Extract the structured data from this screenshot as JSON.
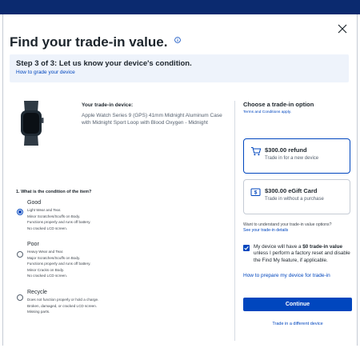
{
  "modal": {
    "title": "Find your trade-in value.",
    "step_title": "Step 3 of 3: Let us know your device's condition.",
    "step_link": "How to grade your device"
  },
  "device": {
    "label": "Your trade-in device:",
    "name": "Apple Watch Series 9 (GPS) 41mm Midnight Aluminum Case with Midnight Sport Loop with Blood Oxygen - Midnight"
  },
  "condition": {
    "question": "1. What is the condition of the item?",
    "options": [
      {
        "name": "Good",
        "selected": true,
        "lines": [
          "Light Wear and Tear.",
          "Minor Scratches/Scuffs on Body.",
          "Functions properly and runs off battery.",
          "No cracked LCD screen."
        ]
      },
      {
        "name": "Poor",
        "selected": false,
        "lines": [
          "Heavy Wear and Tear.",
          "Major Scratches/Scuffs on Body.",
          "Functions properly and runs off battery.",
          "Minor Cracks on Body.",
          "No cracked LCD screen."
        ]
      },
      {
        "name": "Recycle",
        "selected": false,
        "lines": [
          "Does not function properly or hold a charge.",
          "Broken, damaged, or cracked LCD screen.",
          "Missing parts."
        ]
      }
    ]
  },
  "trade_option": {
    "heading": "Choose a trade-in option",
    "terms": "Terms and Conditions apply.",
    "options": [
      {
        "title": "$300.00 refund",
        "subtitle": "Trade in for a new device",
        "icon": "cart-icon",
        "selected": true
      },
      {
        "title": "$300.00 eGift Card",
        "subtitle": "Trade in without a purchase",
        "icon": "dollar-card-icon",
        "selected": false
      }
    ],
    "understand_text": "Want to understand your trade-in value options?",
    "understand_link": "See your trade-in details",
    "check_pre": "My device will have a ",
    "check_bold": "$0 trade-in value",
    "check_post": " unless I perform a factory reset and disable the Find My feature, if applicable.",
    "checked": true,
    "prepare_link": "How to prepare my device for trade-in",
    "continue_label": "Continue",
    "different_link": "Trade in a different device"
  },
  "colors": {
    "accent": "#0046be",
    "band": "#0b2a6f",
    "step_bg": "#eef3fb"
  }
}
